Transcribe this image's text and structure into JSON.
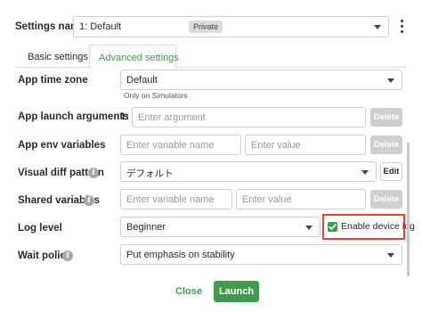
{
  "settings_name": {
    "label": "Settings name",
    "value": "1: Default",
    "badge": "Private",
    "more_icon": "vertical-ellipsis-icon"
  },
  "tabs": [
    {
      "label": "Basic settings",
      "active": false
    },
    {
      "label": "Advanced settings",
      "active": true
    }
  ],
  "rows": {
    "app_time_zone": {
      "label": "App time zone",
      "value": "Default",
      "hint": "Only on Simulators"
    },
    "app_launch_arguments": {
      "label": "App launch arguments",
      "index": "1:",
      "placeholder": "Enter argument",
      "delete_label": "Delete"
    },
    "app_env_variables": {
      "label": "App env variables",
      "name_placeholder": "Enter variable name",
      "value_placeholder": "Enter value",
      "delete_label": "Delete"
    },
    "visual_diff_pattern": {
      "label": "Visual diff pattern",
      "value": "デフォルト",
      "edit_label": "Edit"
    },
    "shared_variables": {
      "label": "Shared variables",
      "name_placeholder": "Enter variable name",
      "value_placeholder": "Enter value",
      "delete_label": "Delete"
    },
    "log_level": {
      "label": "Log level",
      "value": "Beginner",
      "checkbox_label": "Enable device log",
      "checkbox_checked": true
    },
    "wait_policy": {
      "label": "Wait policy",
      "value": "Put emphasis on stability"
    }
  },
  "footer": {
    "close_label": "Close",
    "launch_label": "Launch"
  },
  "colors": {
    "accent_green": "#3f9b4f",
    "highlight_red": "#e0463c",
    "badge_bg": "#d8d8d8"
  }
}
